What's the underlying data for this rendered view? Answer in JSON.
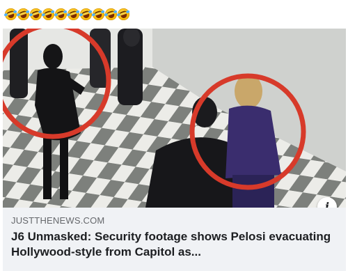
{
  "post": {
    "caption_emojis": [
      "rolling-on-floor-laughing",
      "rolling-on-floor-laughing",
      "rolling-on-floor-laughing",
      "rolling-on-floor-laughing",
      "rolling-on-floor-laughing",
      "rolling-on-floor-laughing",
      "rolling-on-floor-laughing",
      "rolling-on-floor-laughing",
      "rolling-on-floor-laughing",
      "rolling-on-floor-laughing"
    ]
  },
  "link_preview": {
    "domain": "JUSTTHENEWS.COM",
    "headline": "J6 Unmasked: Security footage shows Pelosi evacuating Hollywood-style from Capitol as...",
    "info_icon": "info-icon"
  },
  "colors": {
    "highlight_circle": "#d73a2a",
    "meta_background": "#f0f2f5",
    "headline_text": "#1c1e21",
    "domain_text": "#65676b"
  }
}
